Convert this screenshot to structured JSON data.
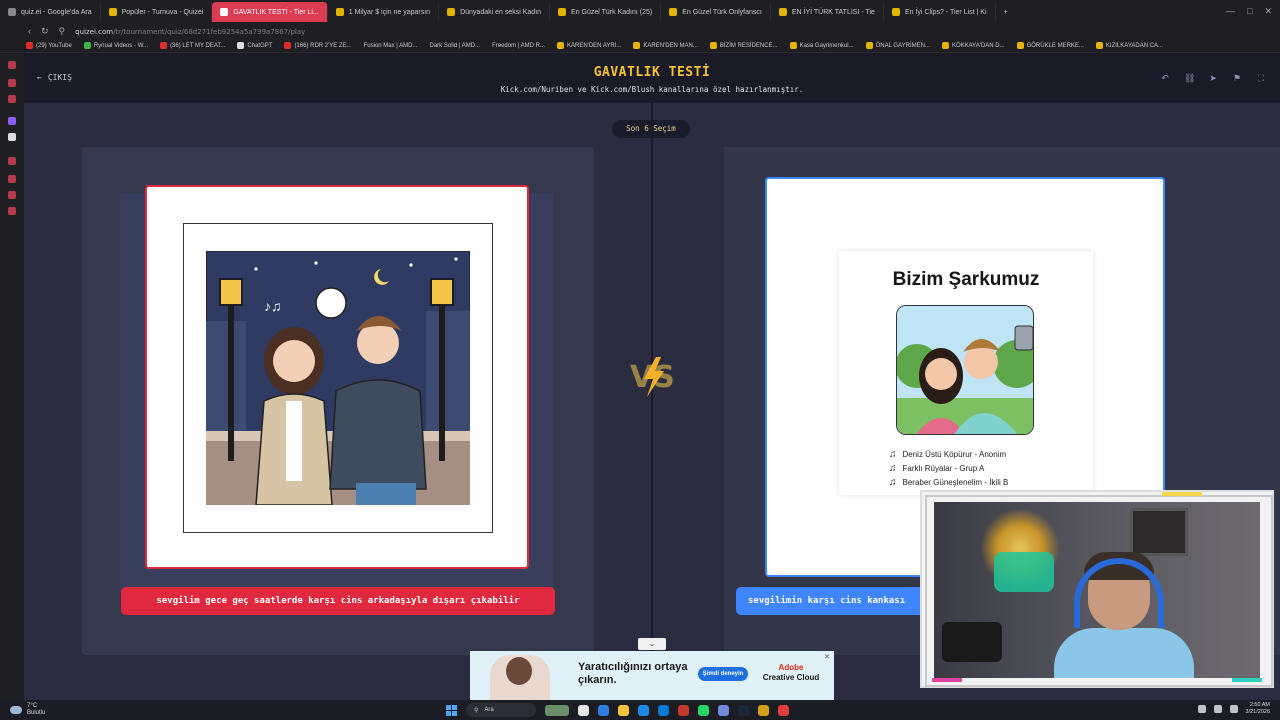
{
  "browser": {
    "tabs": [
      {
        "label": "quiz.ei - Google'da Ara",
        "active": false
      },
      {
        "label": "Popüler - Turnuva - Quizei",
        "active": false
      },
      {
        "label": "GAVATLIK TESTİ - Tier Li...",
        "active": true
      },
      {
        "label": "1 Milyar $ için ne yaparsın",
        "active": false
      },
      {
        "label": "Dünyadaki en seksi Kadın",
        "active": false
      },
      {
        "label": "En Güzel Türk Kadını (25)",
        "active": false
      },
      {
        "label": "En Güzel Türk Onlyfanscı",
        "active": false
      },
      {
        "label": "EN İYİ TÜRK TATLISI - Tie",
        "active": false
      },
      {
        "label": "En İyi Clips? - Tier List | Ki",
        "active": false
      }
    ],
    "url_host": "quizei.com",
    "url_path": "/tr/tournament/quiz/68d271feb9254a5a799a7867/play",
    "bookmarks": [
      {
        "label": "(29) YouTube",
        "color": "#e02b2b"
      },
      {
        "label": "Rynual Videos - W...",
        "color": "#3fb33f"
      },
      {
        "label": "(36) LET MY DEAT...",
        "color": "#e02b2b"
      },
      {
        "label": "ChatGPT",
        "color": "#dddddd"
      },
      {
        "label": "(166) RDR 2'YE ZE...",
        "color": "#e02b2b"
      },
      {
        "label": "Fusion Max | AMD...",
        "color": "#888888"
      },
      {
        "label": "Dark Solid | AMD...",
        "color": "#888888"
      },
      {
        "label": "Freedom | AMD R...",
        "color": "#888888"
      },
      {
        "label": "KAREN'DEN AYRI...",
        "color": "#e5b400"
      },
      {
        "label": "KAREN'DEN MAN...",
        "color": "#e5b400"
      },
      {
        "label": "BİZİM RESİDENCE...",
        "color": "#e5b400"
      },
      {
        "label": "Kasa Gayrimenkul...",
        "color": "#e5b400"
      },
      {
        "label": "ÖNAL GAYRİMEN...",
        "color": "#e5b400"
      },
      {
        "label": "KÖKKAYA'DAN D...",
        "color": "#e5b400"
      },
      {
        "label": "GÖRÜKLE MERKE...",
        "color": "#e5b400"
      },
      {
        "label": "KIZILKAYADAN CA...",
        "color": "#e5b400"
      }
    ]
  },
  "page": {
    "exit_label": "ÇIKIŞ",
    "title": "GAVATLIK TESTİ",
    "subtitle": "Kick.com/Nuriben ve Kick.com/Blush kanallarına özel hazırlanmıştır.",
    "round_label": "Son 6 Seçim",
    "vs_label": "VS"
  },
  "choices": {
    "left": {
      "label": "sevgilim gece geç saatlerde karşı cins arkadaşıyla dışarı çıkabilir",
      "accent": "#e0293e"
    },
    "right": {
      "label": "sevgilimin karşı cins kankası",
      "accent": "#3f85ff",
      "poster_title": "Bizim Şarkumuz",
      "tracks": [
        "Deniz Üstü Köpürur - Anonim",
        "Farklı Rüyalar - Grup A",
        "Beraber Güneşlenelim - İkili B"
      ]
    }
  },
  "ad": {
    "headline": "Yaratıcılığınızı ortaya çıkarın.",
    "cta": "Şimdi deneyin",
    "brand_top": "Adobe",
    "brand_bottom": "Creative Cloud",
    "close": "✕"
  },
  "taskbar": {
    "temp": "7°C",
    "weather": "Bulutlu",
    "search": "Ara",
    "time": "2:50 AM",
    "date": "3/21/2026"
  }
}
